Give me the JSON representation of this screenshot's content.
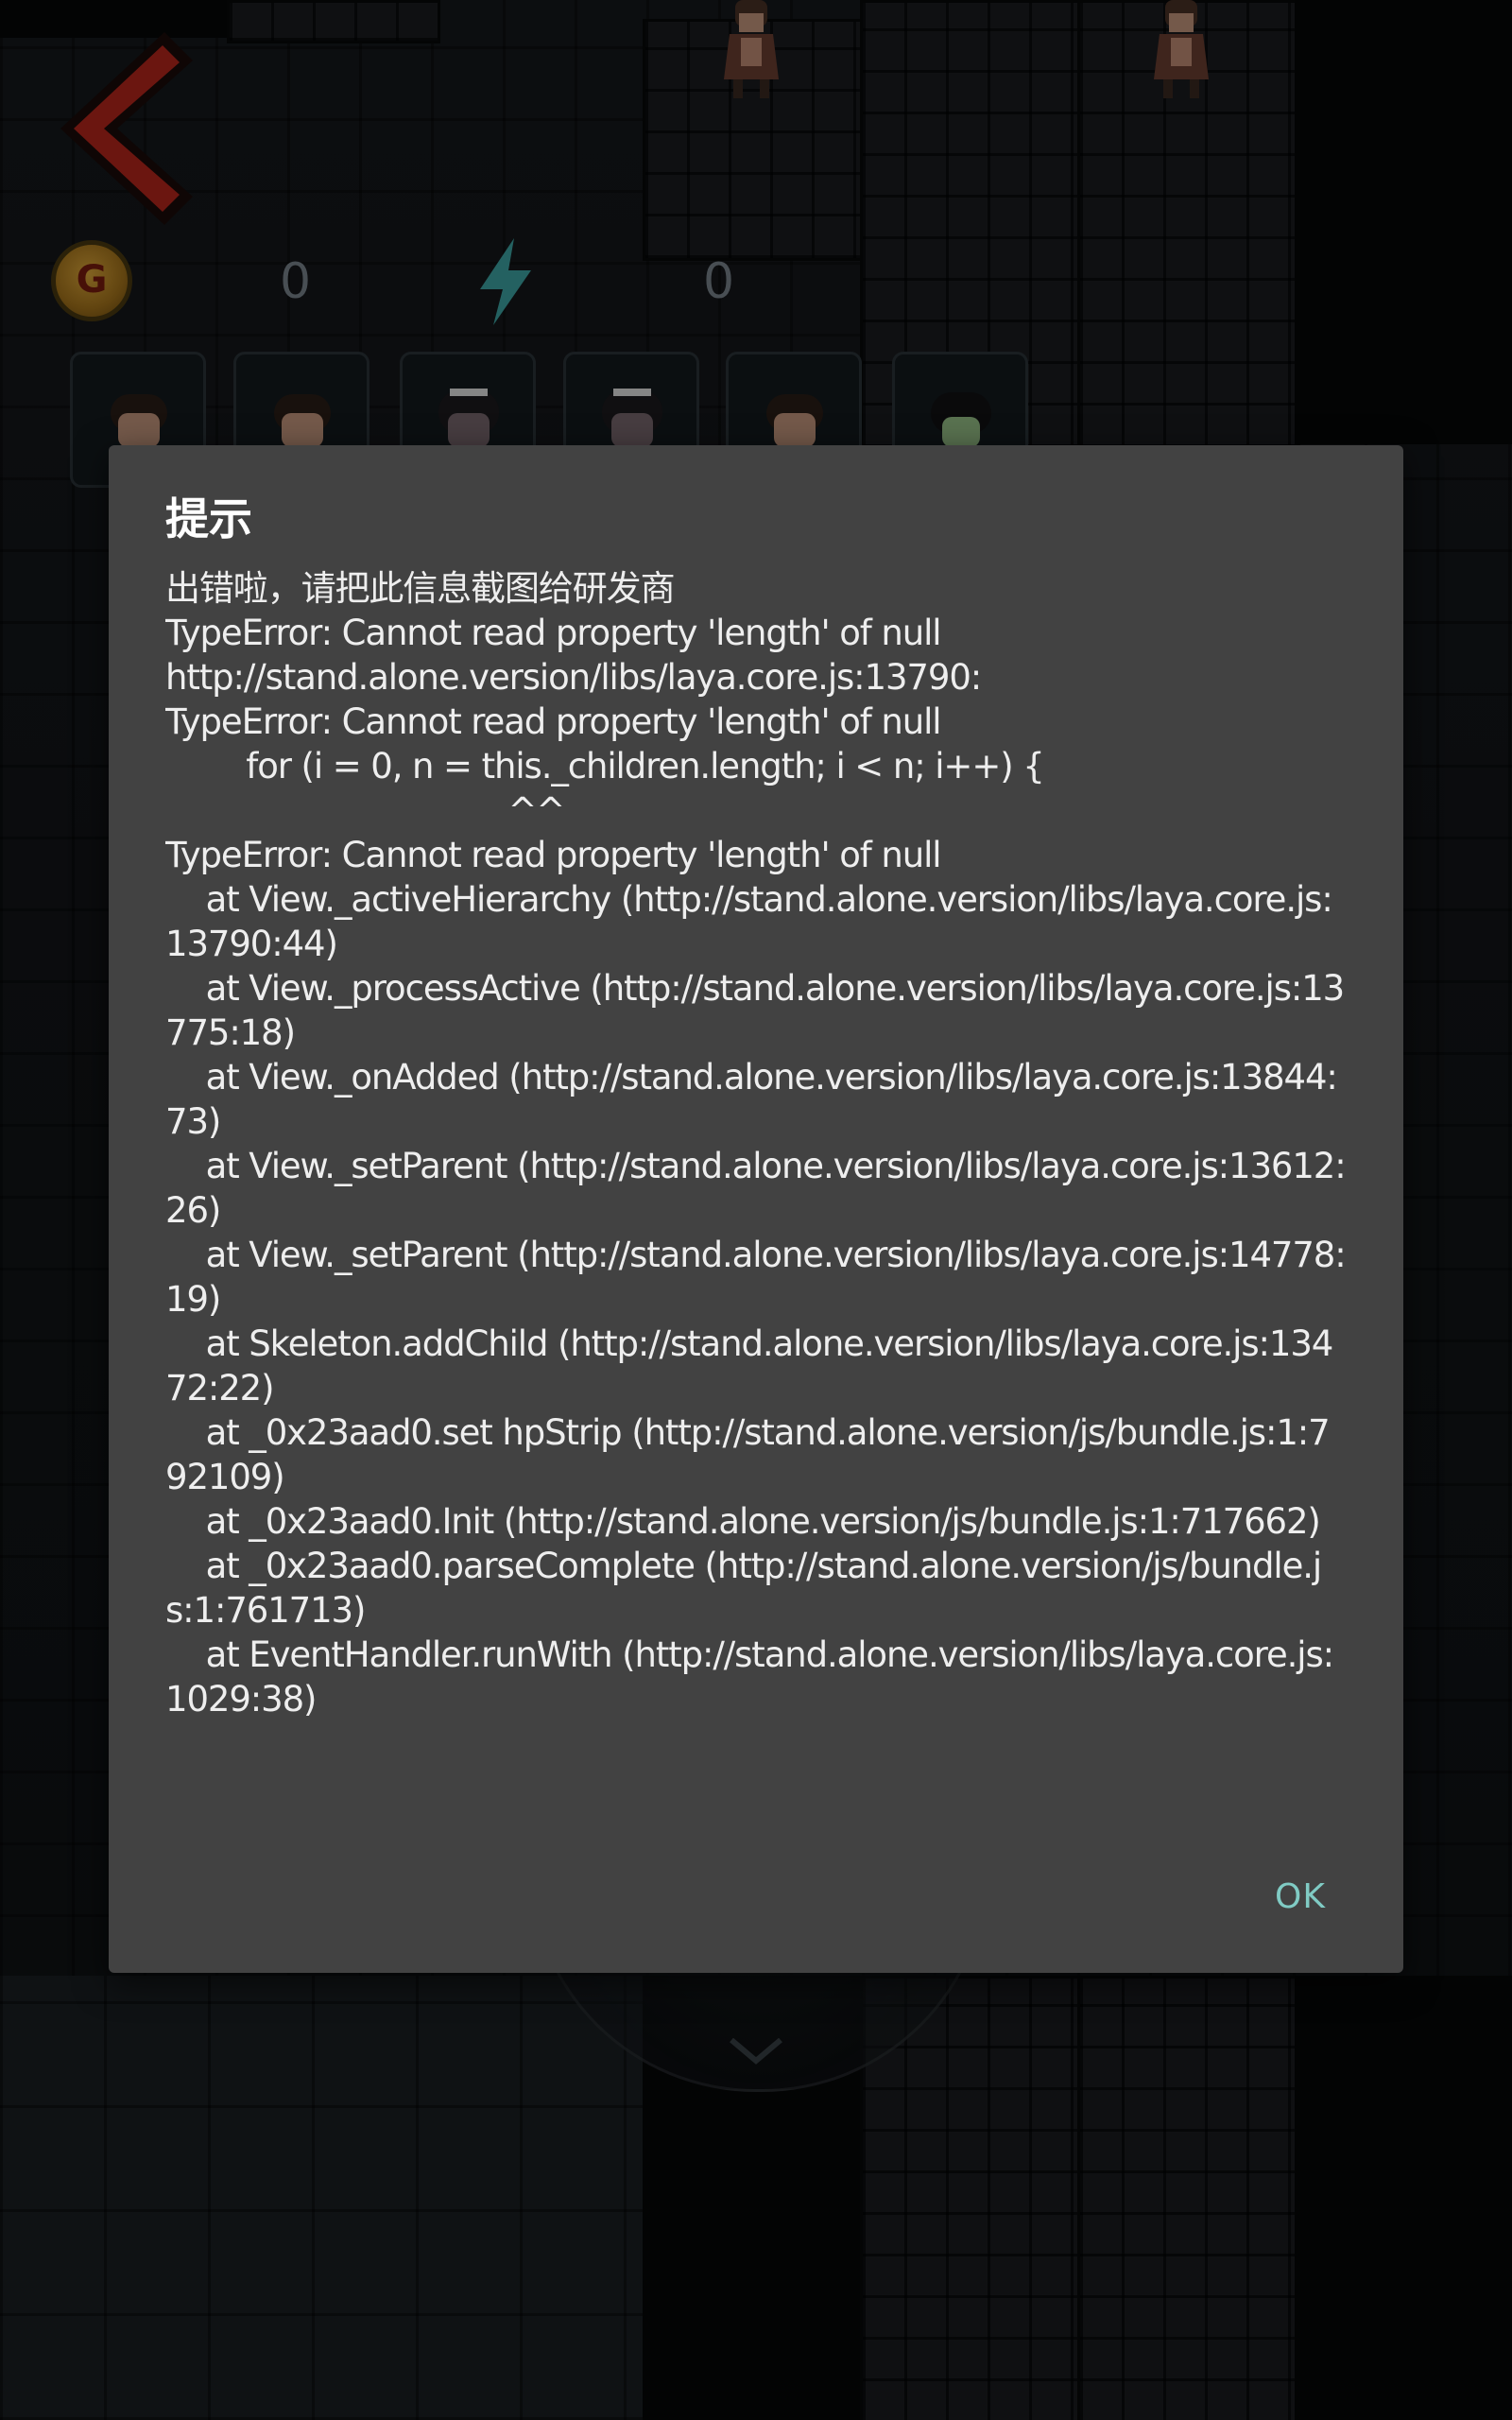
{
  "hud": {
    "coins": "0",
    "energy": "0",
    "coin_icon_letter": "G"
  },
  "hero_slots": [
    "hero-1",
    "hero-2",
    "hero-3",
    "hero-4",
    "hero-5",
    "hero-6"
  ],
  "colors": {
    "dialog_bg": "#424242",
    "dialog_text": "#eeeeee",
    "accent_button": "#80cbc4",
    "back_arrow": "#b8261c",
    "energy_bolt": "#3ea8a8"
  },
  "icons": [
    "back-arrow-icon",
    "gold-coin-icon",
    "lightning-energy-icon",
    "chevron-down-icon"
  ],
  "dialog": {
    "title": "提示",
    "message": "出错啦，请把此信息截图给研发商\nTypeError: Cannot read property 'length' of null\nhttp://stand.alone.version/libs/laya.core.js:13790:\nTypeError: Cannot read property 'length' of null\n        for (i = 0, n = this._children.length; i < n; i++) {\n                                  ^^\nTypeError: Cannot read property 'length' of null\n    at View._activeHierarchy (http://stand.alone.version/libs/laya.core.js:13790:44)\n    at View._processActive (http://stand.alone.version/libs/laya.core.js:13775:18)\n    at View._onAdded (http://stand.alone.version/libs/laya.core.js:13844:73)\n    at View._setParent (http://stand.alone.version/libs/laya.core.js:13612:26)\n    at View._setParent (http://stand.alone.version/libs/laya.core.js:14778:19)\n    at Skeleton.addChild (http://stand.alone.version/libs/laya.core.js:13472:22)\n    at _0x23aad0.set hpStrip (http://stand.alone.version/js/bundle.js:1:792109)\n    at _0x23aad0.Init (http://stand.alone.version/js/bundle.js:1:717662)\n    at _0x23aad0.parseComplete (http://stand.alone.version/js/bundle.js:1:761713)\n    at EventHandler.runWith (http://stand.alone.version/libs/laya.core.js:1029:38)",
    "ok_label": "OK"
  }
}
